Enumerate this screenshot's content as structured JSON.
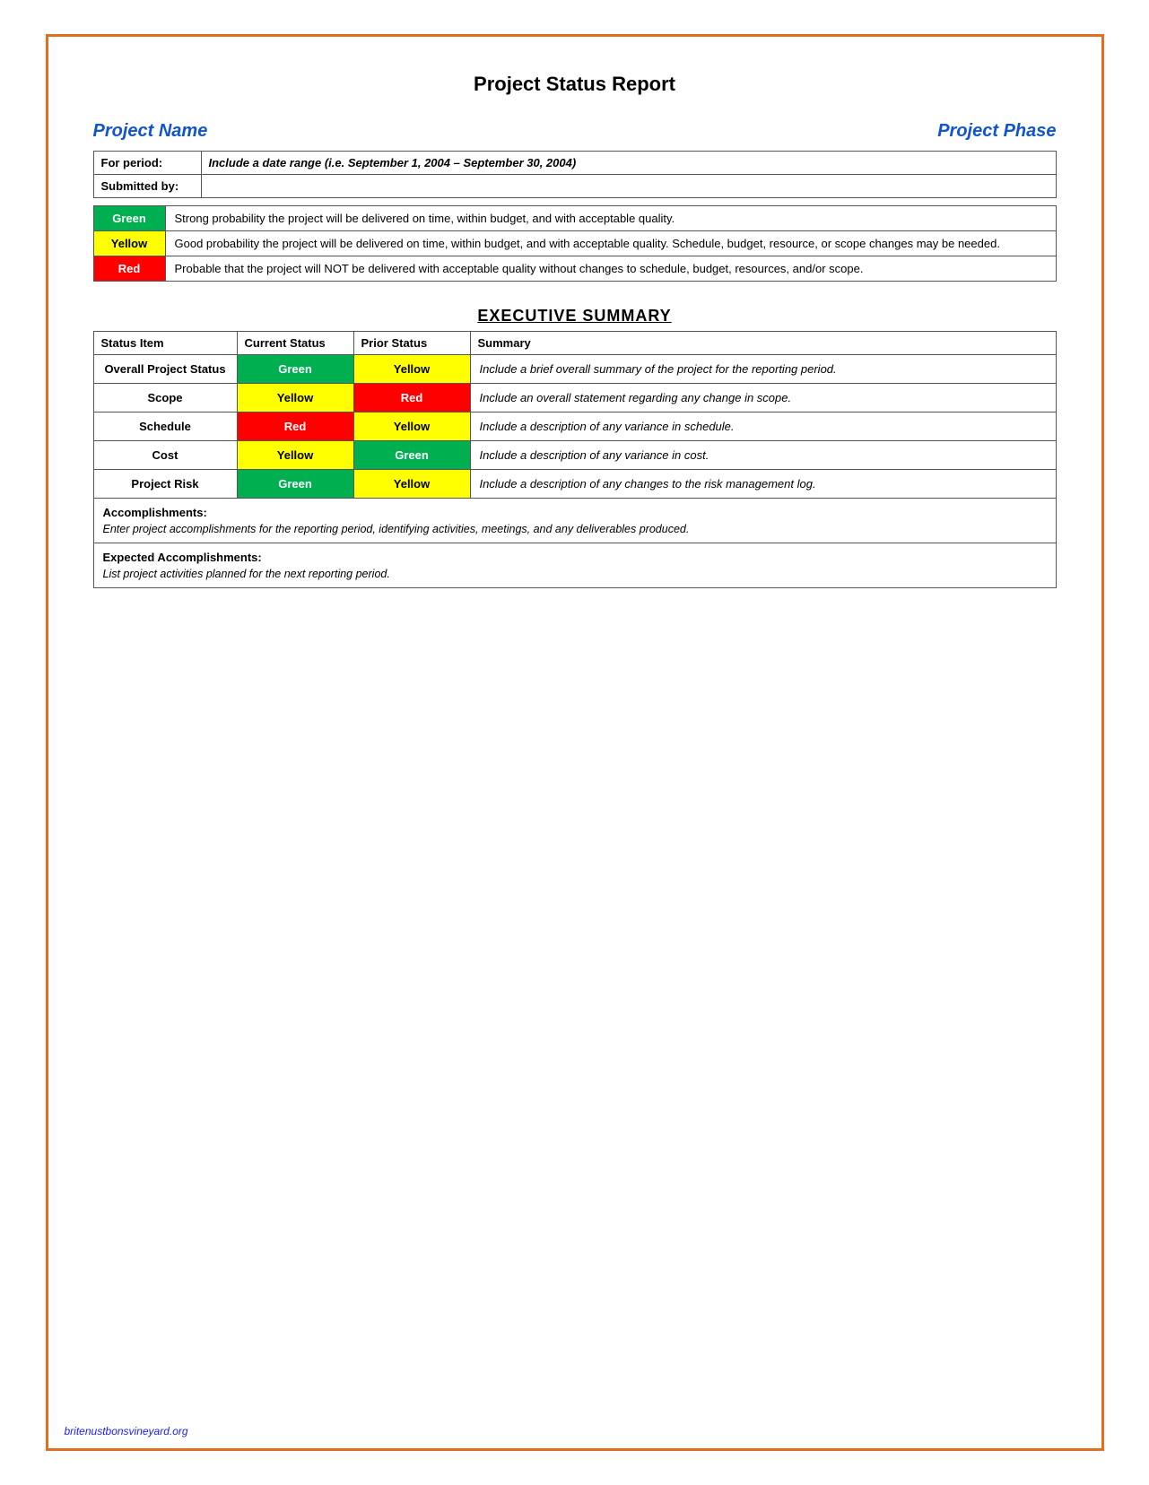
{
  "page": {
    "title": "Project Status Report",
    "border_color": "#e07020"
  },
  "header": {
    "project_name_label": "Project Name",
    "project_phase_label": "Project Phase"
  },
  "info_rows": [
    {
      "label": "For period:",
      "value": "Include a date range (i.e. September 1, 2004 – September 30, 2004)"
    },
    {
      "label": "Submitted by:",
      "value": ""
    }
  ],
  "legend": [
    {
      "color": "green",
      "label": "Green",
      "description": "Strong probability the project will be delivered on time, within budget, and with acceptable quality."
    },
    {
      "color": "yellow",
      "label": "Yellow",
      "description": "Good probability the project will be delivered on time, within budget, and with acceptable quality. Schedule, budget, resource, or scope changes may be needed."
    },
    {
      "color": "red",
      "label": "Red",
      "description": "Probable that the project will NOT be delivered with acceptable quality without changes to schedule, budget, resources, and/or scope."
    }
  ],
  "executive_summary": {
    "section_title": "EXECUTIVE SUMMARY",
    "columns": [
      "Status Item",
      "Current Status",
      "Prior Status",
      "Summary"
    ],
    "rows": [
      {
        "item": "Overall Project Status",
        "current_status": "Green",
        "current_color": "green",
        "prior_status": "Yellow",
        "prior_color": "yellow",
        "summary": "Include a brief overall summary of the project for the reporting period."
      },
      {
        "item": "Scope",
        "current_status": "Yellow",
        "current_color": "yellow",
        "prior_status": "Red",
        "prior_color": "red",
        "summary": "Include an overall statement regarding any change in scope."
      },
      {
        "item": "Schedule",
        "current_status": "Red",
        "current_color": "red",
        "prior_status": "Yellow",
        "prior_color": "yellow",
        "summary": "Include a description of any variance in schedule."
      },
      {
        "item": "Cost",
        "current_status": "Yellow",
        "current_color": "yellow",
        "prior_status": "Green",
        "prior_color": "green",
        "summary": "Include a description of any variance in cost."
      },
      {
        "item": "Project Risk",
        "current_status": "Green",
        "current_color": "green",
        "prior_status": "Yellow",
        "prior_color": "yellow",
        "summary": "Include a description of any changes to the risk management log."
      }
    ]
  },
  "accomplishments": {
    "title": "Accomplishments:",
    "text": "Enter project accomplishments for the reporting period, identifying activities, meetings, and any deliverables produced."
  },
  "expected_accomplishments": {
    "title": "Expected Accomplishments:",
    "text": "List project activities planned for the next reporting period."
  },
  "footer": {
    "text": "britenustbonsvineyard.org"
  }
}
